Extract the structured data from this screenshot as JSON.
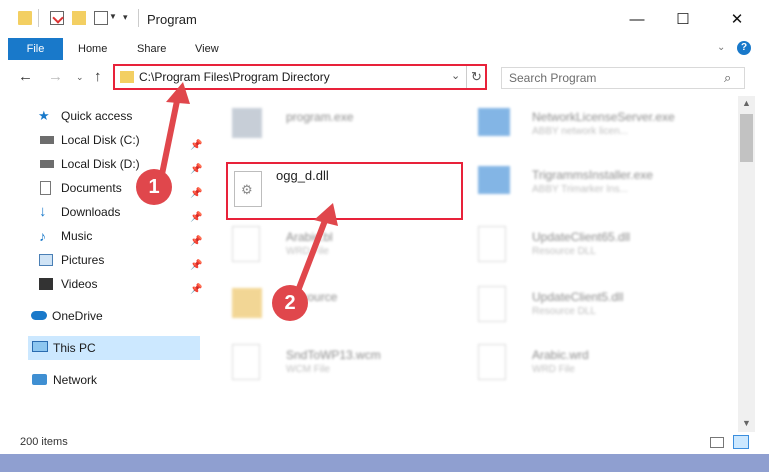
{
  "window": {
    "title": "Program",
    "minimize_glyph": "—",
    "maximize_glyph": "☐",
    "close_glyph": "✕"
  },
  "ribbon": {
    "tabs": [
      "File",
      "Home",
      "Share",
      "View"
    ],
    "help_glyph": "?"
  },
  "address": {
    "path": "C:\\Program Files\\Program Directory",
    "search_placeholder": "Search Program"
  },
  "nav": {
    "items": [
      {
        "label": "Quick access",
        "icon": "star-icon"
      },
      {
        "label": "Local Disk (C:)",
        "icon": "drive-icon",
        "pinned": true
      },
      {
        "label": "Local Disk (D:)",
        "icon": "drive-icon",
        "pinned": true
      },
      {
        "label": "Documents",
        "icon": "documents-icon",
        "pinned": true
      },
      {
        "label": "Downloads",
        "icon": "download-icon",
        "pinned": true
      },
      {
        "label": "Music",
        "icon": "music-icon",
        "pinned": true
      },
      {
        "label": "Pictures",
        "icon": "pictures-icon",
        "pinned": true
      },
      {
        "label": "Videos",
        "icon": "videos-icon",
        "pinned": true
      },
      {
        "label": "OneDrive",
        "icon": "cloud-icon"
      },
      {
        "label": "This PC",
        "icon": "computer-icon",
        "selected": true
      },
      {
        "label": "Network",
        "icon": "network-icon"
      }
    ]
  },
  "files": {
    "program_exe": "program.exe",
    "network_license": {
      "name": "NetworkLicenseServer.exe",
      "desc": "ABBY network licen..."
    },
    "ogg_dll": "ogg_d.dll",
    "trigramms": {
      "name": "TrigrammsInstaller.exe",
      "desc": "ABBY Trimarker Ins..."
    },
    "arabic_bl": {
      "name": "Arabic.bl",
      "desc": "WRD File"
    },
    "update65": {
      "name": "UpdateClient65.dll",
      "desc": "Resource DLL"
    },
    "resource": {
      "name": "Resource"
    },
    "update5": {
      "name": "UpdateClient5.dll",
      "desc": "Resource DLL"
    },
    "sndtowp": {
      "name": "SndToWP13.wcm",
      "desc": "WCM File"
    },
    "arabic_wrd": {
      "name": "Arabic.wrd",
      "desc": "WRD File"
    }
  },
  "annotations": {
    "step1": "1",
    "step2": "2"
  },
  "status": {
    "item_count": "200 items"
  },
  "colors": {
    "accent": "#1979ca",
    "highlight": "#e8223a",
    "arrow": "#e0474c"
  }
}
